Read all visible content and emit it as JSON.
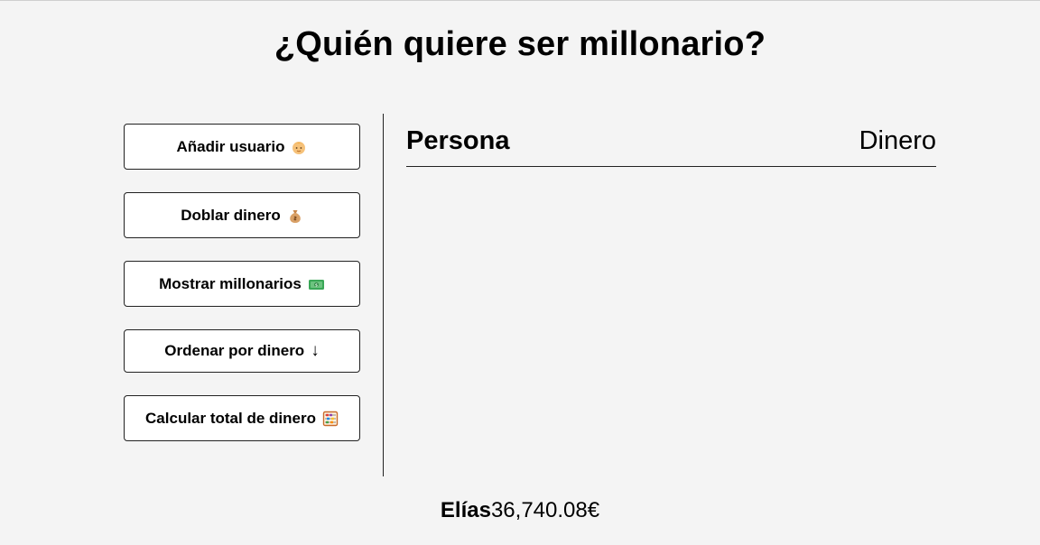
{
  "header": {
    "title": "¿Quién quiere ser millonario?"
  },
  "actions": [
    {
      "label": "Añadir usuario",
      "icon": "baby-face-icon"
    },
    {
      "label": "Doblar dinero",
      "icon": "money-bag-icon"
    },
    {
      "label": "Mostrar millonarios",
      "icon": "banknote-icon"
    },
    {
      "label": "Ordenar por dinero",
      "icon": "down-arrow-icon",
      "glyph": "↓"
    },
    {
      "label": "Calcular total de dinero",
      "icon": "abacus-icon"
    }
  ],
  "table": {
    "col_person": "Persona",
    "col_money": "Dinero"
  },
  "total": {
    "name": "Elías",
    "amount": "36,740.08€"
  },
  "colors": {
    "background": "#f4f4f4",
    "button_bg": "#ffffff",
    "border": "#222222"
  }
}
